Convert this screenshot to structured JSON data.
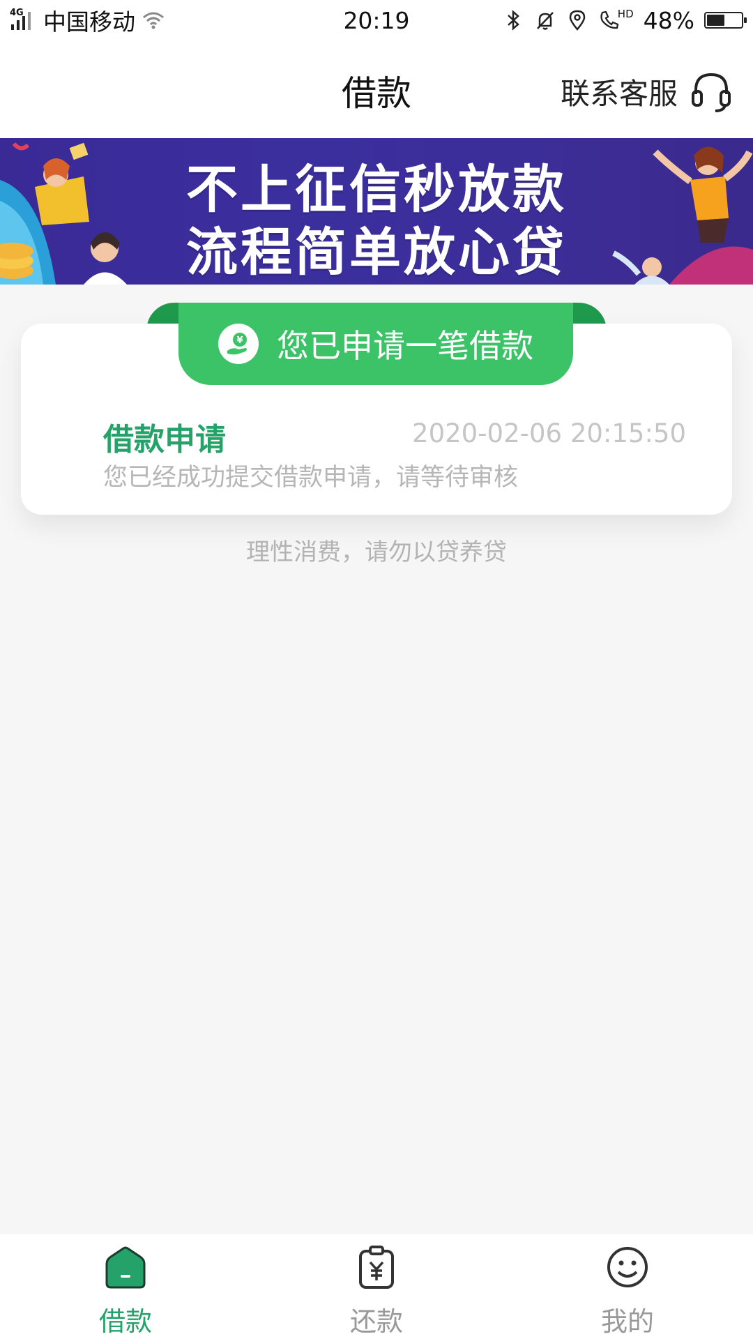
{
  "status_bar": {
    "network": "4G",
    "carrier": "中国移动",
    "time": "20:19",
    "battery": "48%",
    "battery_level": 0.48,
    "call_hd": "HD",
    "icons": [
      "signal-icon",
      "wifi-icon",
      "bluetooth-icon",
      "mute-bell-icon",
      "location-icon",
      "hd-call-icon",
      "battery-icon"
    ]
  },
  "header": {
    "title": "借款",
    "contact_label": "联系客服",
    "contact_icon": "headset-icon"
  },
  "banner": {
    "line1": "不上征信秒放款",
    "line2": "流程简单放心贷"
  },
  "application": {
    "status_text": "您已申请一笔借款",
    "status_icon": "loan-hand-icon",
    "item_title": "借款申请",
    "item_time": "2020-02-06 20:15:50",
    "item_desc": "您已经成功提交借款申请，请等待审核"
  },
  "footer_note": "理性消费，请勿以贷养贷",
  "tabs": [
    {
      "label": "借款",
      "icon": "home-icon",
      "active": true
    },
    {
      "label": "还款",
      "icon": "repay-clipboard-icon",
      "active": false
    },
    {
      "label": "我的",
      "icon": "smile-icon",
      "active": false
    }
  ],
  "colors": {
    "accent_green": "#25a16a",
    "pill_green": "#3cc367",
    "banner_purple": "#3b2f9e",
    "background": "#f6f6f6"
  }
}
